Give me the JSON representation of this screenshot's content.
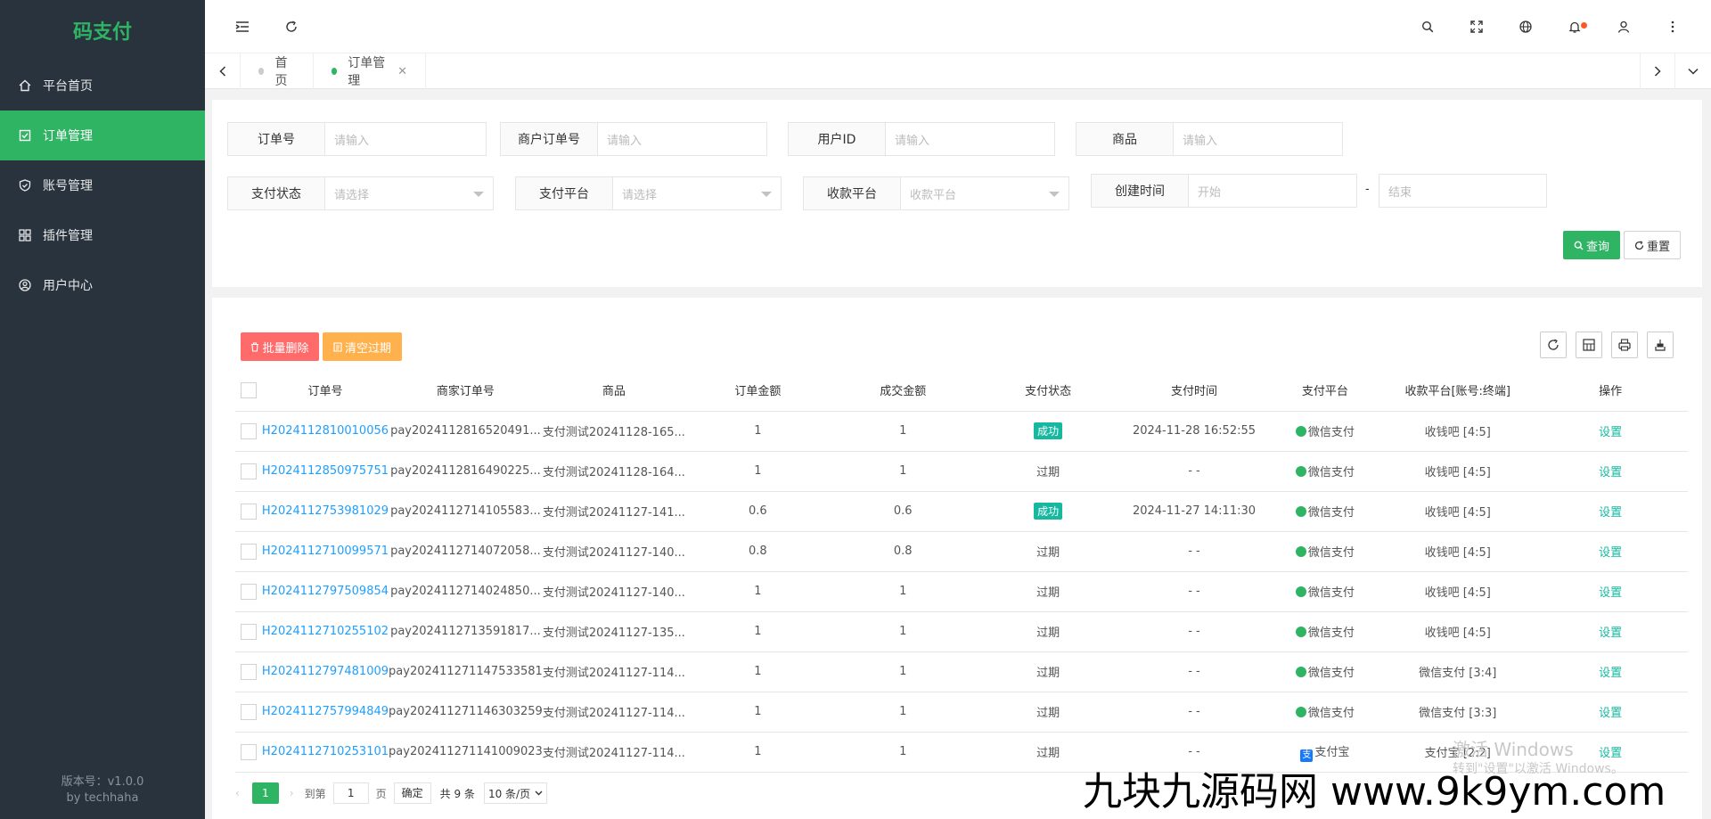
{
  "sidebar": {
    "logo": "码支付",
    "items": [
      {
        "label": "平台首页",
        "icon": "home-icon",
        "active": false
      },
      {
        "label": "订单管理",
        "icon": "checklist-icon",
        "active": true
      },
      {
        "label": "账号管理",
        "icon": "shield-icon",
        "active": false
      },
      {
        "label": "插件管理",
        "icon": "grid-icon",
        "active": false
      },
      {
        "label": "用户中心",
        "icon": "user-circle-icon",
        "active": false
      }
    ],
    "version": "版本号：v1.0.0",
    "author": "by techhaha"
  },
  "tabs": [
    {
      "label": "首页",
      "active": false
    },
    {
      "label": "订单管理",
      "active": true
    }
  ],
  "filters": {
    "order_no": {
      "label": "订单号",
      "placeholder": "请输入"
    },
    "merchant_no": {
      "label": "商户订单号",
      "placeholder": "请输入"
    },
    "user_id": {
      "label": "用户ID",
      "placeholder": "请输入"
    },
    "product": {
      "label": "商品",
      "placeholder": "请输入"
    },
    "pay_status": {
      "label": "支付状态",
      "placeholder": "请选择"
    },
    "pay_platform": {
      "label": "支付平台",
      "placeholder": "请选择"
    },
    "collect_platform": {
      "label": "收款平台",
      "placeholder": "收款平台"
    },
    "created_time": {
      "label": "创建时间",
      "start": "开始",
      "end": "结束",
      "sep": "-"
    },
    "search_label": "查询",
    "reset_label": "重置"
  },
  "toolbar": {
    "batch_delete": "批量删除",
    "clear_expired": "清空过期"
  },
  "table": {
    "columns": [
      "订单号",
      "商家订单号",
      "商品",
      "订单金额",
      "成交金额",
      "支付状态",
      "支付时间",
      "支付平台",
      "收款平台[账号:终端]",
      "操作"
    ],
    "rows": [
      {
        "order": "H2024112810010056",
        "merchant": "pay2024112816520491...",
        "product": "支付测试20241128-165...",
        "amount": "1",
        "paid": "1",
        "status": "成功",
        "time": "2024-11-28 16:52:55",
        "platform": "微信支付",
        "platform_type": "wx",
        "collect": "收钱吧 [4:5]",
        "op": "设置"
      },
      {
        "order": "H2024112850975751",
        "merchant": "pay2024112816490225...",
        "product": "支付测试20241128-164...",
        "amount": "1",
        "paid": "1",
        "status": "过期",
        "time": "- -",
        "platform": "微信支付",
        "platform_type": "wx",
        "collect": "收钱吧 [4:5]",
        "op": "设置"
      },
      {
        "order": "H2024112753981029",
        "merchant": "pay2024112714105583...",
        "product": "支付测试20241127-141...",
        "amount": "0.6",
        "paid": "0.6",
        "status": "成功",
        "time": "2024-11-27 14:11:30",
        "platform": "微信支付",
        "platform_type": "wx",
        "collect": "收钱吧 [4:5]",
        "op": "设置"
      },
      {
        "order": "H2024112710099571",
        "merchant": "pay2024112714072058...",
        "product": "支付测试20241127-140...",
        "amount": "0.8",
        "paid": "0.8",
        "status": "过期",
        "time": "- -",
        "platform": "微信支付",
        "platform_type": "wx",
        "collect": "收钱吧 [4:5]",
        "op": "设置"
      },
      {
        "order": "H2024112797509854",
        "merchant": "pay2024112714024850...",
        "product": "支付测试20241127-140...",
        "amount": "1",
        "paid": "1",
        "status": "过期",
        "time": "- -",
        "platform": "微信支付",
        "platform_type": "wx",
        "collect": "收钱吧 [4:5]",
        "op": "设置"
      },
      {
        "order": "H2024112710255102",
        "merchant": "pay2024112713591817...",
        "product": "支付测试20241127-135...",
        "amount": "1",
        "paid": "1",
        "status": "过期",
        "time": "- -",
        "platform": "微信支付",
        "platform_type": "wx",
        "collect": "收钱吧 [4:5]",
        "op": "设置"
      },
      {
        "order": "H2024112797481009",
        "merchant": "pay202411271147533581",
        "product": "支付测试20241127-114...",
        "amount": "1",
        "paid": "1",
        "status": "过期",
        "time": "- -",
        "platform": "微信支付",
        "platform_type": "wx",
        "collect": "微信支付 [3:4]",
        "op": "设置"
      },
      {
        "order": "H2024112757994849",
        "merchant": "pay202411271146303259",
        "product": "支付测试20241127-114...",
        "amount": "1",
        "paid": "1",
        "status": "过期",
        "time": "- -",
        "platform": "微信支付",
        "platform_type": "wx",
        "collect": "微信支付 [3:3]",
        "op": "设置"
      },
      {
        "order": "H2024112710253101",
        "merchant": "pay202411271141009023",
        "product": "支付测试20241127-114...",
        "amount": "1",
        "paid": "1",
        "status": "过期",
        "time": "- -",
        "platform": "支付宝",
        "platform_type": "ali",
        "collect": "支付宝 [2:2]",
        "op": "设置"
      }
    ]
  },
  "pager": {
    "current": "1",
    "goto": "到第",
    "page_input": "1",
    "page_unit": "页",
    "confirm": "确定",
    "total": "共 9 条",
    "per_page": "10 条/页"
  },
  "overlay": {
    "watermark": "九块九源码网 www.9k9ym.com",
    "win_title": "激活 Windows",
    "win_sub": "转到\"设置\"以激活 Windows。"
  },
  "colors": {
    "brand": "#2fb463",
    "sidebar": "#28333e",
    "link": "#1e9fff",
    "teal": "#16b9a0",
    "danger": "#ff5722",
    "warn": "#ffb800"
  }
}
